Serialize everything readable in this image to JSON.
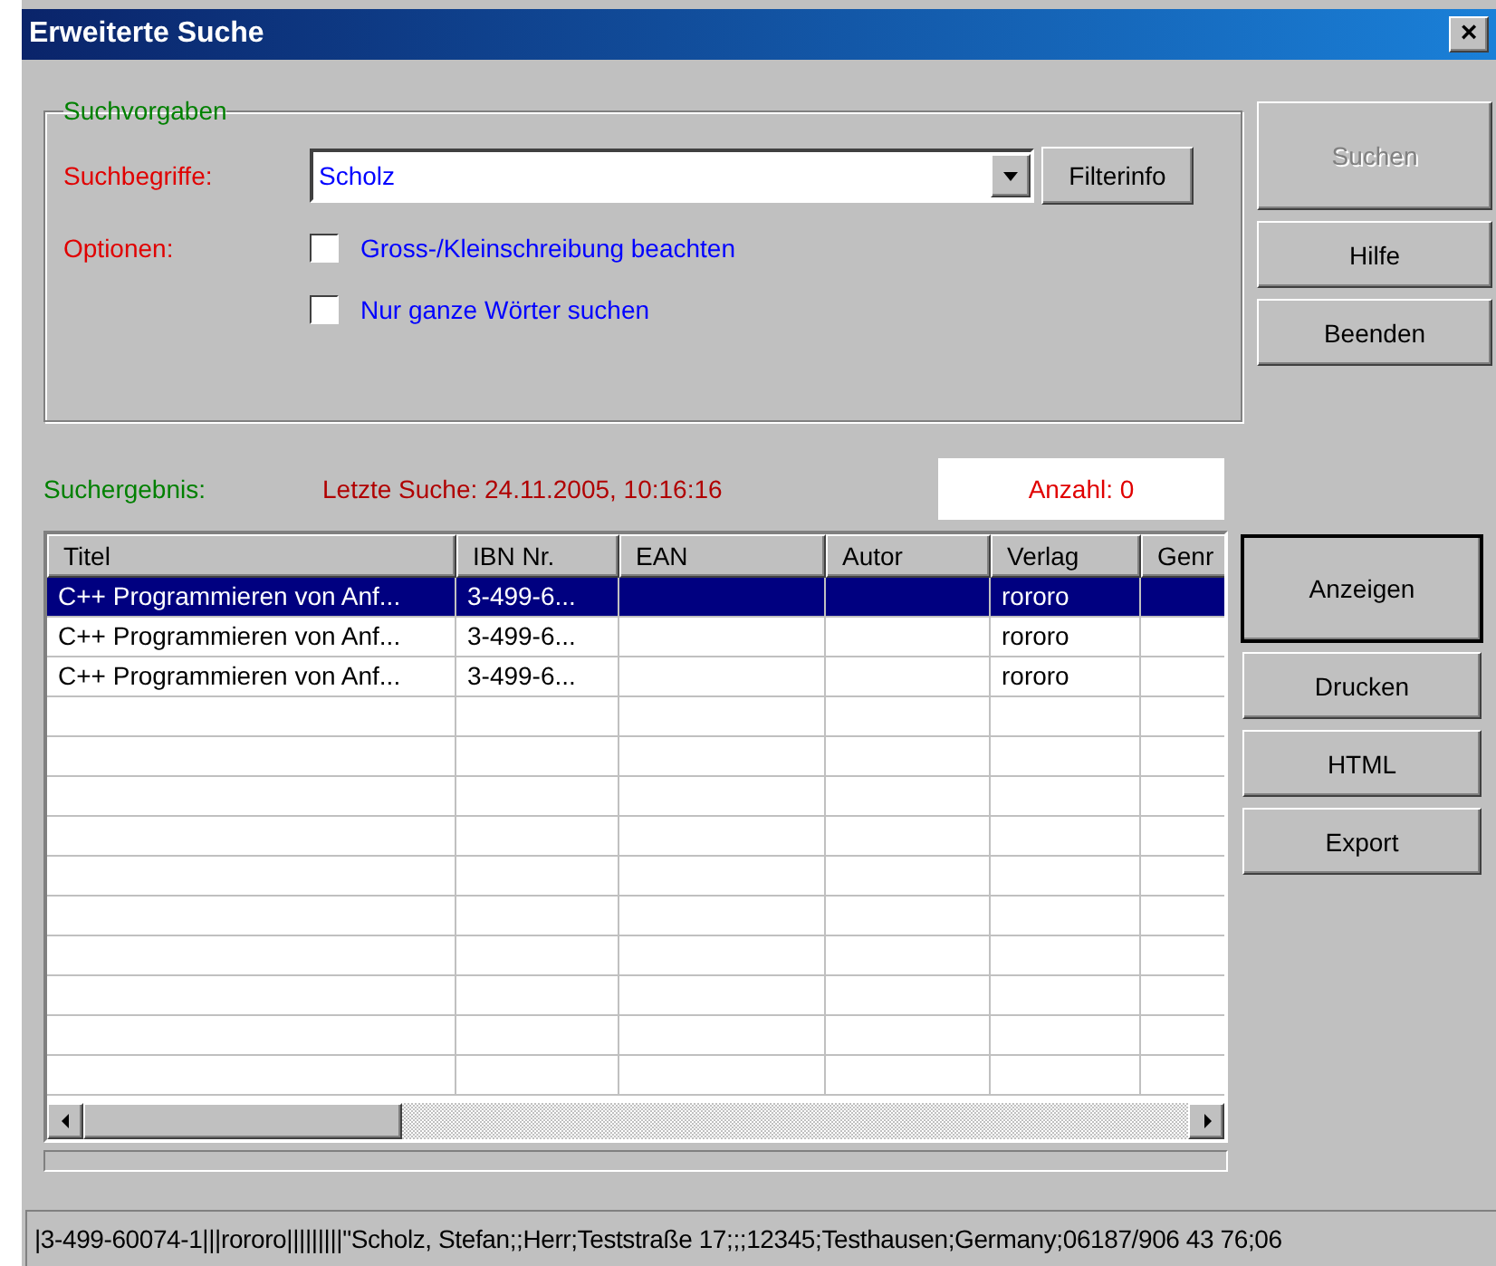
{
  "window": {
    "title": "Erweiterte Suche",
    "close": "×"
  },
  "search_group": {
    "title": "Suchvorgaben",
    "term_label": "Suchbegriffe:",
    "term_value": "Scholz",
    "filter_button": "Filterinfo",
    "options_label": "Optionen:",
    "options": [
      {
        "label": "Gross-/Kleinschreibung beachten",
        "checked": false
      },
      {
        "label": "Nur ganze Wörter suchen",
        "checked": false
      }
    ]
  },
  "side_buttons": [
    {
      "label": "Suchen",
      "disabled": true
    },
    {
      "label": "Hilfe",
      "disabled": false
    },
    {
      "label": "Beenden",
      "disabled": false
    }
  ],
  "result": {
    "label": "Suchergebnis:",
    "last_search": "Letzte Suche: 24.11.2005, 10:16:16",
    "count": "Anzahl: 0"
  },
  "table": {
    "columns": [
      "Titel",
      "IBN Nr.",
      "EAN",
      "Autor",
      "Verlag",
      "Genr"
    ],
    "rows": [
      {
        "cells": [
          "C++ Programmieren von Anf...",
          "3-499-6...",
          "",
          "",
          "rororo",
          ""
        ],
        "selected": true
      },
      {
        "cells": [
          "C++ Programmieren von Anf...",
          "3-499-6...",
          "",
          "",
          "rororo",
          ""
        ],
        "selected": false
      },
      {
        "cells": [
          "C++ Programmieren von Anf...",
          "3-499-6...",
          "",
          "",
          "rororo",
          ""
        ],
        "selected": false
      }
    ]
  },
  "progress": {
    "level": 0
  },
  "result_buttons": [
    {
      "label": "Anzeigen",
      "default": true
    },
    {
      "label": "Drucken",
      "default": false
    },
    {
      "label": "HTML",
      "default": false
    },
    {
      "label": "Export",
      "default": false
    }
  ],
  "status_bar": "|3-499-60074-1|||rororo|||||||||\"Scholz, Stefan;;Herr;Teststraße 17;;;12345;Testhausen;Germany;06187/906 43 76;06"
}
